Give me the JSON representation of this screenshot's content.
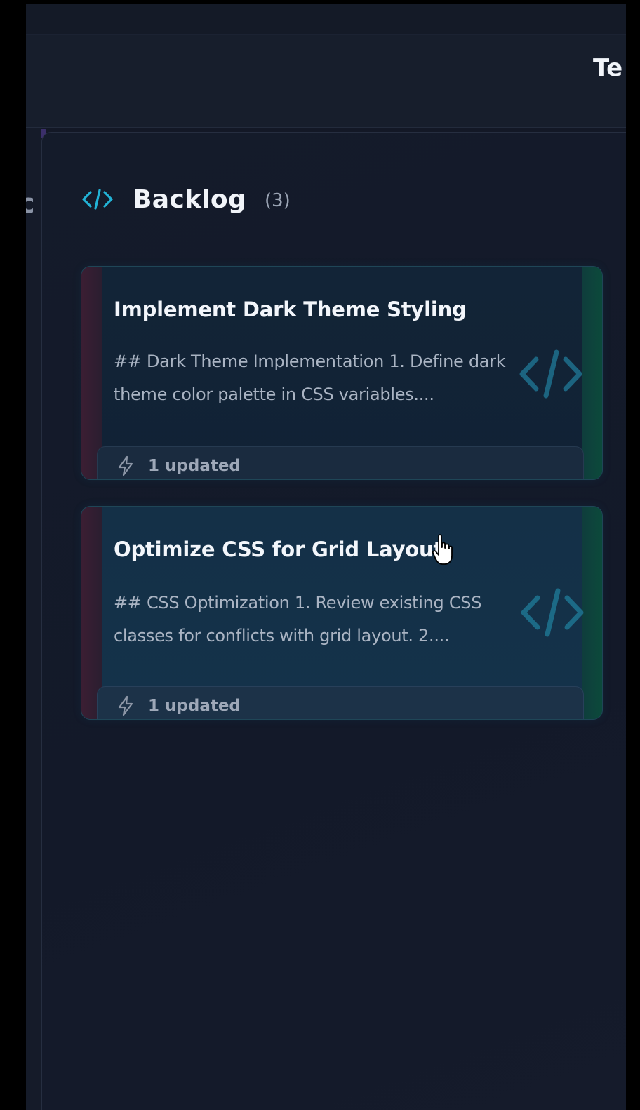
{
  "header": {
    "title": "Te"
  },
  "left_edge": {
    "glyph": "c"
  },
  "column": {
    "title": "Backlog",
    "count": "(3)",
    "icon": "code-icon"
  },
  "cards": [
    {
      "title": "Implement Dark Theme Styling",
      "description": "## Dark Theme Implementation 1. Define dark theme color palette in CSS variables....",
      "footer": "1 updated",
      "footer_icon": "lightning-icon",
      "decor_icon": "code-icon"
    },
    {
      "title": "Optimize CSS for Grid Layout",
      "description": "## CSS Optimization 1. Review existing CSS classes for conflicts with grid layout. 2....",
      "footer": "1 updated",
      "footer_icon": "lightning-icon",
      "decor_icon": "code-icon"
    }
  ],
  "colors": {
    "accent": "#22b3d6",
    "card_border": "#1f4657",
    "stripe_left": "#3b1e33",
    "stripe_right": "#0c4a3b"
  }
}
